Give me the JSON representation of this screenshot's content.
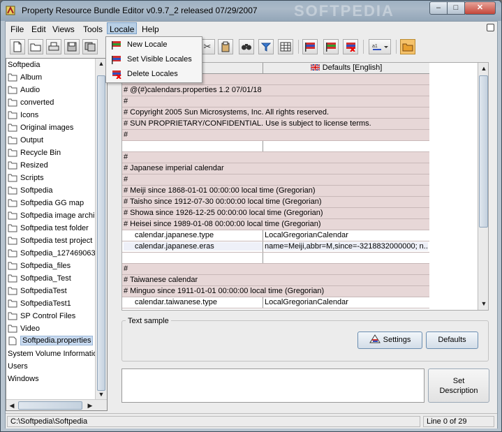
{
  "window": {
    "title": "Property Resource Bundle Editor v0.9.7_2 released  07/29/2007",
    "watermark": "SOFTPEDIA",
    "minimize": "–",
    "maximize": "□",
    "close": "✕"
  },
  "menubar": [
    "File",
    "Edit",
    "Views",
    "Tools",
    "Locale",
    "Help"
  ],
  "locale_menu": [
    "New Locale",
    "Set Visible Locales",
    "Delete Locales"
  ],
  "toolbar": {
    "icons": [
      "new-file-icon",
      "open-icon",
      "print-icon",
      "save-icon",
      "save-all-icon",
      "cut-icon",
      "paste-icon",
      "find-icon",
      "filter-icon",
      "table-icon",
      "locale-flag-icon",
      "locale-flag-add-icon",
      "locale-flag-delete-icon",
      "sort-icon",
      "folder-icon"
    ],
    "glyphs": {
      "cut": "✂",
      "paste": "📋",
      "find": "⚉",
      "filter": "▽",
      "table": "▦"
    }
  },
  "tree": [
    {
      "label": "Softpedia",
      "indent": 0,
      "folder": false
    },
    {
      "label": "Album",
      "indent": 1,
      "folder": true
    },
    {
      "label": "Audio",
      "indent": 1,
      "folder": true
    },
    {
      "label": "converted",
      "indent": 1,
      "folder": true
    },
    {
      "label": "Icons",
      "indent": 1,
      "folder": true
    },
    {
      "label": "Original images",
      "indent": 1,
      "folder": true
    },
    {
      "label": "Output",
      "indent": 1,
      "folder": true
    },
    {
      "label": "Recycle Bin",
      "indent": 1,
      "folder": true
    },
    {
      "label": "Resized",
      "indent": 1,
      "folder": true
    },
    {
      "label": "Scripts",
      "indent": 1,
      "folder": true
    },
    {
      "label": "Softpedia",
      "indent": 1,
      "folder": true
    },
    {
      "label": "Softpedia GG map",
      "indent": 1,
      "folder": true
    },
    {
      "label": "Softpedia image archi",
      "indent": 1,
      "folder": true
    },
    {
      "label": "Softpedia test folder",
      "indent": 1,
      "folder": true
    },
    {
      "label": "Softpedia test project",
      "indent": 1,
      "folder": true
    },
    {
      "label": "Softpedia_127469063",
      "indent": 1,
      "folder": true
    },
    {
      "label": "Softpedia_files",
      "indent": 1,
      "folder": true
    },
    {
      "label": "Softpedia_Test",
      "indent": 1,
      "folder": true
    },
    {
      "label": "SoftpediaTest",
      "indent": 1,
      "folder": true
    },
    {
      "label": "SoftpediaTest1",
      "indent": 1,
      "folder": true
    },
    {
      "label": "SP Control Files",
      "indent": 1,
      "folder": true
    },
    {
      "label": "Video",
      "indent": 1,
      "folder": true
    },
    {
      "label": "Softpedia.properties",
      "indent": 1,
      "folder": false,
      "file": true,
      "selected": true
    },
    {
      "label": "System Volume Informatio",
      "indent": 0,
      "folder": false
    },
    {
      "label": "Users",
      "indent": 0,
      "folder": false
    },
    {
      "label": "Windows",
      "indent": 0,
      "folder": false
    }
  ],
  "table": {
    "header_key": "",
    "header_locale": "Defaults [English]",
    "rows": [
      {
        "type": "comment",
        "text": ""
      },
      {
        "type": "comment",
        "text": "# @(#)calendars.properties                   1.2 07/01/18"
      },
      {
        "type": "comment",
        "text": "#"
      },
      {
        "type": "comment",
        "text": "# Copyright 2005 Sun Microsystems, Inc. All rights reserved."
      },
      {
        "type": "comment",
        "text": "# SUN PROPRIETARY/CONFIDENTIAL. Use is subject to license terms."
      },
      {
        "type": "comment",
        "text": "#"
      },
      {
        "type": "blank",
        "key": "",
        "value": ""
      },
      {
        "type": "comment",
        "text": "#"
      },
      {
        "type": "comment",
        "text": "# Japanese imperial calendar"
      },
      {
        "type": "comment",
        "text": "#"
      },
      {
        "type": "comment",
        "text": "#   Meiji  since 1868-01-01 00:00:00 local time (Gregorian)"
      },
      {
        "type": "comment",
        "text": "#   Taisho since 1912-07-30 00:00:00 local time (Gregorian)"
      },
      {
        "type": "comment",
        "text": "#   Showa  since 1926-12-25 00:00:00 local time (Gregorian)"
      },
      {
        "type": "comment",
        "text": "#   Heisei since 1989-01-08 00:00:00 local time (Gregorian)"
      },
      {
        "type": "kv",
        "key": "calendar.japanese.type",
        "value": "LocalGregorianCalendar"
      },
      {
        "type": "kv",
        "key": "calendar.japanese.eras",
        "value": "name=Meiji,abbr=M,since=-3218832000000;  n...",
        "selected": true
      },
      {
        "type": "blank",
        "key": "",
        "value": ""
      },
      {
        "type": "comment",
        "text": "#"
      },
      {
        "type": "comment",
        "text": "# Taiwanese calendar"
      },
      {
        "type": "comment",
        "text": "#   Minguo since 1911-01-01 00:00:00 local time (Gregorian)"
      },
      {
        "type": "kv",
        "key": "calendar.taiwanese.type",
        "value": "LocalGregorianCalendar"
      }
    ]
  },
  "text_sample": {
    "legend": "Text sample",
    "settings_button": "Settings",
    "defaults_button": "Defaults"
  },
  "description": {
    "value": "",
    "set_button_line1": "Set",
    "set_button_line2": "Description"
  },
  "status": {
    "path": "C:\\Softpedia\\Softpedia",
    "line": "Line 0 of 29"
  },
  "colors": {
    "comment_row": "#e7d7d7",
    "selection": "#c8daf0",
    "titlebar": "#9eb1c2"
  }
}
